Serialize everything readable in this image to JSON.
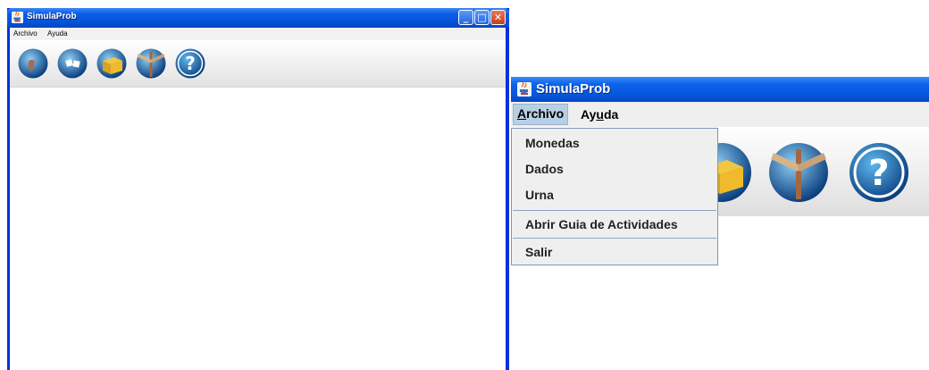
{
  "small_window": {
    "title": "SimulaProb",
    "menus": [
      "Archivo",
      "Ayuda"
    ]
  },
  "big_window": {
    "title": "SimulaProb",
    "menus": [
      {
        "label": "Archivo",
        "mnemonic": "A",
        "open": true
      },
      {
        "label": "Ayuda",
        "mnemonic": "u",
        "open": false
      }
    ]
  },
  "archivo_menu": {
    "items": [
      "Monedas",
      "Dados",
      "Urna",
      "Abrir Guia de Actividades",
      "Salir"
    ]
  },
  "toolbar_icons": [
    "globe-icon",
    "dice-icon",
    "box-icon",
    "signpost-icon",
    "help-icon"
  ],
  "colors": {
    "titlebar": "#0553d8",
    "menu_highlight": "#b8cfe5",
    "menu_background": "#efefef",
    "close_button": "#c3401e"
  }
}
